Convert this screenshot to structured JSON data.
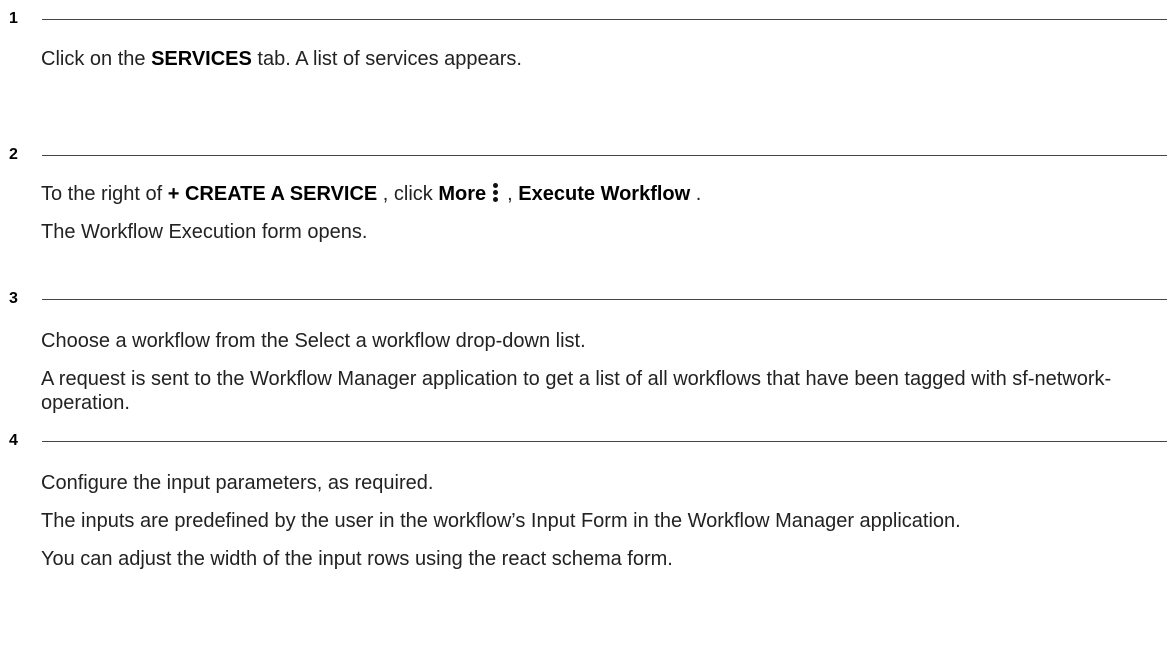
{
  "steps": [
    {
      "number": "1",
      "lines": [
        {
          "pre": "Click on the ",
          "bold": "SERVICES",
          "post": " tab. A list of services appears."
        }
      ]
    },
    {
      "number": "2",
      "line1": {
        "pre": "To the right of ",
        "bold1": "+ CREATE A SERVICE",
        "mid": " , click ",
        "bold2": "More",
        "icon": "more-vertical-icon",
        "sep": ", ",
        "bold3": "Execute Workflow",
        "post": " ."
      },
      "line2": "The Workflow Execution form opens."
    },
    {
      "number": "3",
      "line1": "Choose a workflow from the Select a workflow drop-down list.",
      "line2": "A request is sent to the Workflow Manager application to get a list of all workflows that have been tagged with sf-network-operation."
    },
    {
      "number": "4",
      "line1": "Configure the input parameters, as required.",
      "line2": "The inputs are predefined by the user in the workflow’s Input Form in the Workflow Manager application.",
      "line3": "You can adjust the width of the input rows using the react schema form."
    }
  ]
}
